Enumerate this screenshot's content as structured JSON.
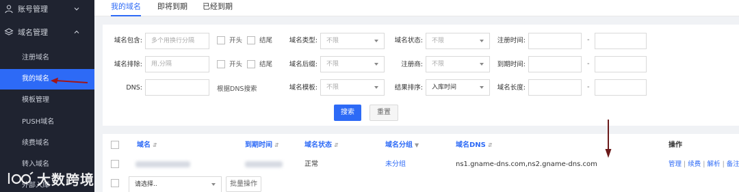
{
  "sidebar": {
    "account_group": "账号管理",
    "domain_group": "域名管理",
    "items": [
      {
        "label": "注册域名"
      },
      {
        "label": "我的域名"
      },
      {
        "label": "模板管理"
      },
      {
        "label": "PUSH域名"
      },
      {
        "label": "续费域名"
      },
      {
        "label": "转入域名"
      },
      {
        "label": "外部入库"
      }
    ],
    "accent_color": "#2d6af6"
  },
  "tabs": [
    "我的域名",
    "即将到期",
    "已经到期"
  ],
  "filter": {
    "contains_label": "域名包含:",
    "contains_placeholder": "多个用换行分隔",
    "exclude_label": "域名排除:",
    "exclude_placeholder": "用,分隔",
    "dns_label": "DNS:",
    "dns_hint": "根据DNS搜索",
    "start_label": "开头",
    "end_label": "结尾",
    "type_label": "域名类型:",
    "suffix_label": "域名后缀:",
    "template_label": "域名模板:",
    "any": "不限",
    "status_label": "域名状态:",
    "registrar_label": "注册商:",
    "sort_label": "结果排序:",
    "sort_value": "入库时间",
    "reg_time_label": "注册时间:",
    "expire_time_label": "到期时间:",
    "length_label": "域名长度:",
    "range_dash": "-",
    "search_button": "搜索",
    "reset_button": "重置"
  },
  "table": {
    "headers": {
      "domain": "域名",
      "expire": "到期时间",
      "status": "域名状态",
      "group": "域名分组",
      "dns": "域名DNS",
      "actions": "操作"
    },
    "rows": [
      {
        "status": "正常",
        "group": "未分组",
        "dns": "ns1.gname-dns.com,ns2.gname-dns.com",
        "actions": [
          "管理",
          "续费",
          "解析",
          "备注"
        ]
      }
    ],
    "bulk_select": "请选择..",
    "bulk_button": "批量操作"
  },
  "watermark": {
    "text": "大数跨境"
  }
}
